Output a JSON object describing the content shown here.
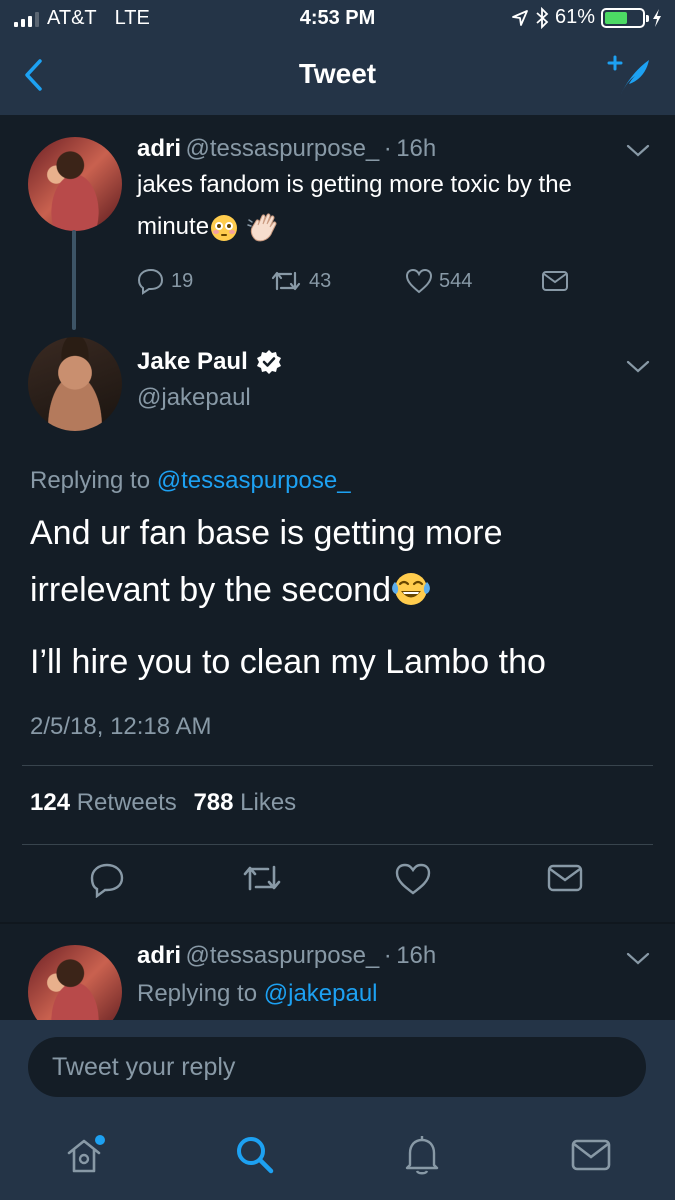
{
  "status_bar": {
    "carrier": "AT&T",
    "network": "LTE",
    "time": "4:53 PM",
    "battery": "61%",
    "battery_level": 0.61
  },
  "nav": {
    "title": "Tweet"
  },
  "parent_tweet": {
    "name": "adri",
    "handle": "@tessaspurpose_",
    "separator": "·",
    "time": "16h",
    "text": "jakes fandom is getting more toxic by the minute",
    "emojis": [
      "flushed-face",
      "waving-hand"
    ],
    "replies": "19",
    "retweets": "43",
    "likes": "544"
  },
  "main_tweet": {
    "name": "Jake Paul",
    "verified": true,
    "handle": "@jakepaul",
    "replying_prefix": "Replying to",
    "replying_to": "@tessaspurpose_",
    "line1": "And ur fan base is getting more",
    "line2": "irrelevant by the second",
    "line3": "I’ll hire you to clean my Lambo tho",
    "emoji": "face-with-tears-of-joy",
    "timestamp": "2/5/18, 12:18 AM",
    "retweets_count": "124",
    "retweets_label": "Retweets",
    "likes_count": "788",
    "likes_label": "Likes"
  },
  "reply_tweet": {
    "name": "adri",
    "handle": "@tessaspurpose_",
    "separator": "·",
    "time": "16h",
    "replying_prefix": "Replying to",
    "replying_to": "@jakepaul"
  },
  "reply_box": {
    "placeholder": "Tweet your reply"
  },
  "colors": {
    "background": "#141d26",
    "bar": "#243447",
    "accent": "#1da1f2",
    "muted": "#8899a6"
  }
}
